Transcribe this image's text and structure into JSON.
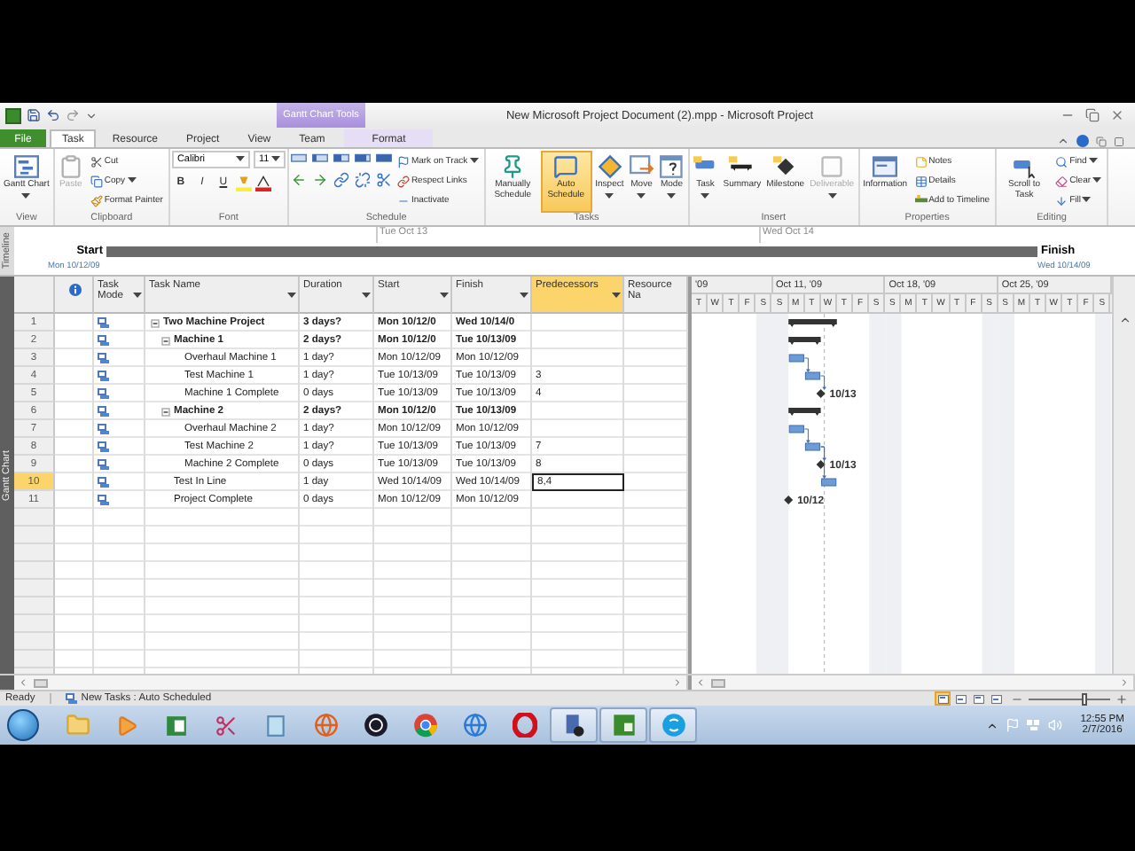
{
  "title_bar": {
    "title": "New Microsoft Project Document (2).mpp - Microsoft Project",
    "context_label": "Gantt Chart Tools"
  },
  "tabs": [
    {
      "label": "File",
      "kind": "file",
      "selected": false
    },
    {
      "label": "Task",
      "kind": "tab",
      "selected": true
    },
    {
      "label": "Resource",
      "kind": "tab",
      "selected": false
    },
    {
      "label": "Project",
      "kind": "tab",
      "selected": false
    },
    {
      "label": "View",
      "kind": "tab",
      "selected": false
    },
    {
      "label": "Team",
      "kind": "tab",
      "selected": false
    },
    {
      "label": "Format",
      "kind": "context",
      "selected": false
    }
  ],
  "ribbon": [
    {
      "label": "View",
      "kind": "buttons",
      "large": [
        {
          "label": "Gantt Chart",
          "dropdown": true,
          "disabled": false
        }
      ]
    },
    {
      "label": "Clipboard",
      "kind": "buttons",
      "large": [
        {
          "label": "Paste",
          "dropdown": false,
          "disabled": true
        }
      ],
      "small": [
        {
          "label": "Cut",
          "dropdown": false,
          "disabled": false
        },
        {
          "label": "Copy",
          "dropdown": true,
          "disabled": false
        },
        {
          "label": "Format Painter",
          "dropdown": false,
          "disabled": false
        }
      ]
    },
    {
      "label": "Font",
      "kind": "font",
      "font": "Calibri",
      "size": "11",
      "styles": [
        "B",
        "I",
        "U"
      ]
    },
    {
      "label": "Schedule",
      "kind": "schedule",
      "small": [
        {
          "label": "Mark on Track",
          "dropdown": true,
          "disabled": false
        },
        {
          "label": "Respect Links",
          "dropdown": false,
          "disabled": false
        },
        {
          "label": "Inactivate",
          "dropdown": false,
          "disabled": false
        }
      ]
    },
    {
      "label": "Tasks",
      "kind": "buttons",
      "large": [
        {
          "label": "Manually Schedule",
          "dropdown": false,
          "disabled": false,
          "selected": false
        },
        {
          "label": "Auto Schedule",
          "dropdown": false,
          "disabled": false,
          "selected": true
        },
        {
          "label": "Inspect",
          "dropdown": true,
          "disabled": false,
          "selected": false
        },
        {
          "label": "Move",
          "dropdown": true,
          "disabled": false,
          "selected": false
        },
        {
          "label": "Mode",
          "dropdown": true,
          "disabled": false,
          "selected": false
        }
      ]
    },
    {
      "label": "Insert",
      "kind": "buttons",
      "large": [
        {
          "label": "Task",
          "dropdown": true,
          "disabled": false
        },
        {
          "label": "Summary",
          "dropdown": false,
          "disabled": false
        },
        {
          "label": "Milestone",
          "dropdown": false,
          "disabled": false
        },
        {
          "label": "Deliverable",
          "dropdown": true,
          "disabled": true
        }
      ]
    },
    {
      "label": "Properties",
      "kind": "buttons",
      "large": [
        {
          "label": "Information",
          "dropdown": false,
          "disabled": false
        }
      ],
      "small": [
        {
          "label": "Notes",
          "dropdown": false,
          "disabled": false
        },
        {
          "label": "Details",
          "dropdown": false,
          "disabled": false
        },
        {
          "label": "Add to Timeline",
          "dropdown": false,
          "disabled": false
        }
      ]
    },
    {
      "label": "Editing",
      "kind": "buttons",
      "large": [
        {
          "label": "Scroll to Task",
          "dropdown": false,
          "disabled": false
        }
      ],
      "small": [
        {
          "label": "Find",
          "dropdown": true,
          "disabled": false
        },
        {
          "label": "Clear",
          "dropdown": true,
          "disabled": false
        },
        {
          "label": "Fill",
          "dropdown": true,
          "disabled": false
        }
      ]
    }
  ],
  "timeline": {
    "side_label": "Timeline",
    "start_label": "Start",
    "finish_label": "Finish",
    "start_date": "Mon 10/12/09",
    "finish_date": "Wed 10/14/09",
    "ticks": [
      "Tue Oct 13",
      "Wed Oct 14"
    ]
  },
  "table": {
    "side_label": "Gantt Chart",
    "columns": [
      {
        "kind": "info",
        "selected": false
      },
      {
        "label": "Task Mode",
        "kind": "text",
        "selected": false
      },
      {
        "label": "Task Name",
        "kind": "text",
        "selected": false
      },
      {
        "label": "Duration",
        "kind": "text",
        "selected": false
      },
      {
        "label": "Start",
        "kind": "text",
        "selected": false
      },
      {
        "label": "Finish",
        "kind": "text",
        "selected": false
      },
      {
        "label": "Predecessors",
        "kind": "text",
        "selected": true
      },
      {
        "label": "Resource Na",
        "kind": "text",
        "selected": false
      }
    ],
    "tasks": [
      {
        "id": "1",
        "name": "Two Machine Project",
        "duration": "3 days?",
        "start": "Mon 10/12/0",
        "finish": "Wed 10/14/0",
        "kind": "summary",
        "expanded": true,
        "selected": false,
        "children": [
          {
            "id": "2",
            "name": "Machine 1",
            "duration": "2 days?",
            "start": "Mon 10/12/0",
            "finish": "Tue 10/13/09",
            "kind": "summary",
            "expanded": true,
            "selected": false,
            "children": [
              {
                "id": "3",
                "name": "Overhaul Machine 1",
                "duration": "1 day?",
                "start": "Mon 10/12/09",
                "finish": "Mon 10/12/09",
                "kind": "task",
                "selected": false
              },
              {
                "id": "4",
                "name": "Test Machine 1",
                "duration": "1 day?",
                "start": "Tue 10/13/09",
                "finish": "Tue 10/13/09",
                "predecessors": "3",
                "kind": "task",
                "selected": false
              },
              {
                "id": "5",
                "name": "Machine 1 Complete",
                "duration": "0 days",
                "start": "Tue 10/13/09",
                "finish": "Tue 10/13/09",
                "predecessors": "4",
                "kind": "milestone",
                "bar_label": "10/13",
                "selected": false
              }
            ]
          },
          {
            "id": "6",
            "name": "Machine 2",
            "duration": "2 days?",
            "start": "Mon 10/12/0",
            "finish": "Tue 10/13/09",
            "kind": "summary",
            "expanded": true,
            "selected": false,
            "children": [
              {
                "id": "7",
                "name": "Overhaul Machine 2",
                "duration": "1 day?",
                "start": "Mon 10/12/09",
                "finish": "Mon 10/12/09",
                "kind": "task",
                "selected": false
              },
              {
                "id": "8",
                "name": "Test Machine 2",
                "duration": "1 day?",
                "start": "Tue 10/13/09",
                "finish": "Tue 10/13/09",
                "predecessors": "7",
                "kind": "task",
                "selected": false
              },
              {
                "id": "9",
                "name": "Machine 2 Complete",
                "duration": "0 days",
                "start": "Tue 10/13/09",
                "finish": "Tue 10/13/09",
                "predecessors": "8",
                "kind": "milestone",
                "bar_label": "10/13",
                "selected": false
              }
            ]
          },
          {
            "id": "10",
            "name": "Test In Line",
            "duration": "1 day",
            "start": "Wed 10/14/09",
            "finish": "Wed 10/14/09",
            "predecessors": "8,4",
            "kind": "task",
            "selected": true
          },
          {
            "id": "11",
            "name": "Project Complete",
            "duration": "0 days",
            "start": "Mon 10/12/09",
            "finish": "Mon 10/12/09",
            "kind": "milestone",
            "bar_label": "10/12",
            "selected": false
          }
        ]
      }
    ]
  },
  "gantt": {
    "timescale": [
      {
        "label": "'09",
        "days": [
          "T",
          "W",
          "T",
          "F",
          "S"
        ]
      },
      {
        "label": "Oct 11, '09",
        "days": [
          "S",
          "M",
          "T",
          "W",
          "T",
          "F",
          "S"
        ]
      },
      {
        "label": "Oct 18, '09",
        "days": [
          "S",
          "M",
          "T",
          "W",
          "T",
          "F",
          "S"
        ]
      },
      {
        "label": "Oct 25, '09",
        "days": [
          "S",
          "M",
          "T",
          "W",
          "T",
          "F",
          "S"
        ]
      }
    ]
  },
  "status_bar": {
    "ready": "Ready",
    "mode": "New Tasks : Auto Scheduled",
    "views": [
      {
        "selected": true
      },
      {
        "selected": false
      },
      {
        "selected": false
      },
      {
        "selected": false
      }
    ],
    "zoom": {
      "level": 0.7
    }
  },
  "taskbar": {
    "apps": [
      {
        "running": false
      },
      {
        "running": false
      },
      {
        "running": false
      },
      {
        "running": false
      },
      {
        "running": false
      },
      {
        "running": false
      },
      {
        "running": false
      },
      {
        "running": false
      },
      {
        "running": false
      },
      {
        "running": false
      },
      {
        "running": true
      },
      {
        "running": true
      },
      {
        "running": true
      }
    ],
    "clock": {
      "time": "12:55 PM",
      "date": "2/7/2016"
    }
  }
}
